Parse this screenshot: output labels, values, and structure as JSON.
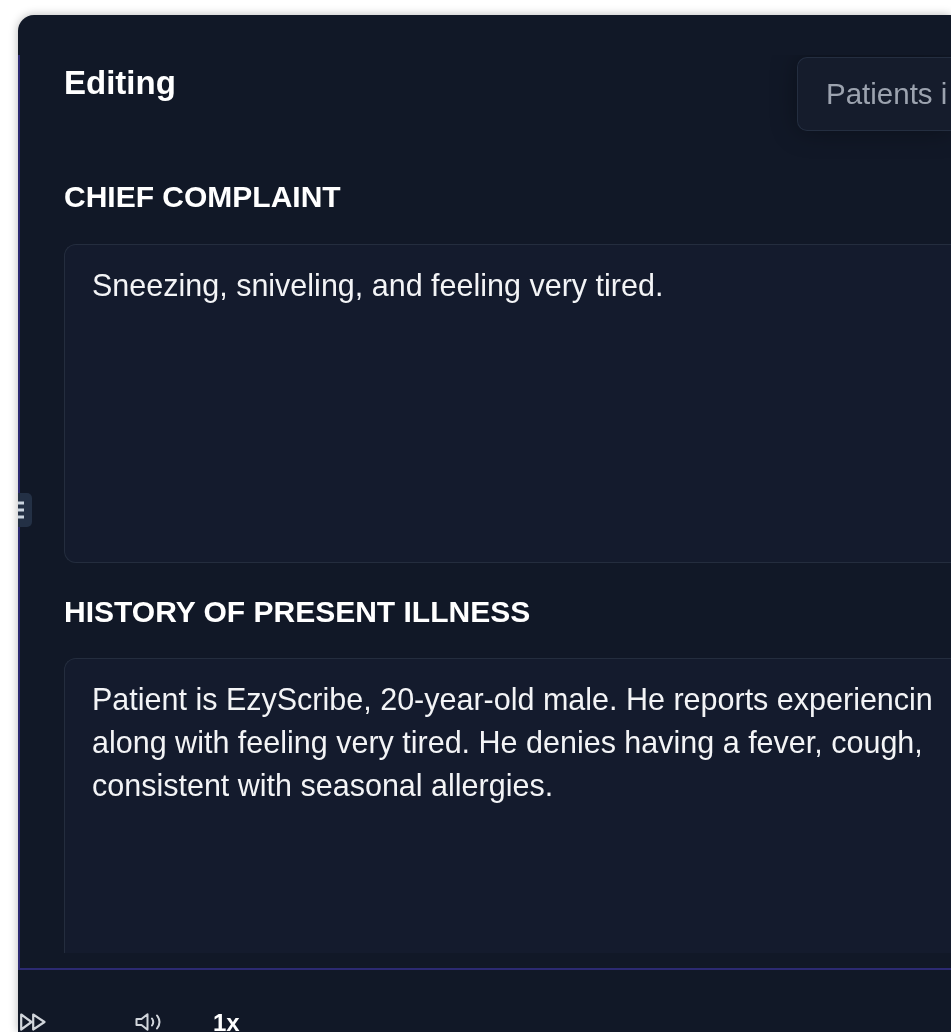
{
  "header": {
    "title": "Editing",
    "patient_field": {
      "placeholder": "Patients i"
    }
  },
  "sections": [
    {
      "heading": "CHIEF COMPLAINT",
      "value": "Sneezing, sniveling, and feeling very tired."
    },
    {
      "heading": "HISTORY OF PRESENT ILLNESS",
      "value": "Patient is EzyScribe, 20-year-old male. He reports experiencin\nalong with feeling very tired. He denies having a fever, cough,\nconsistent with seasonal allergies."
    }
  ],
  "player": {
    "speed": "1x"
  }
}
